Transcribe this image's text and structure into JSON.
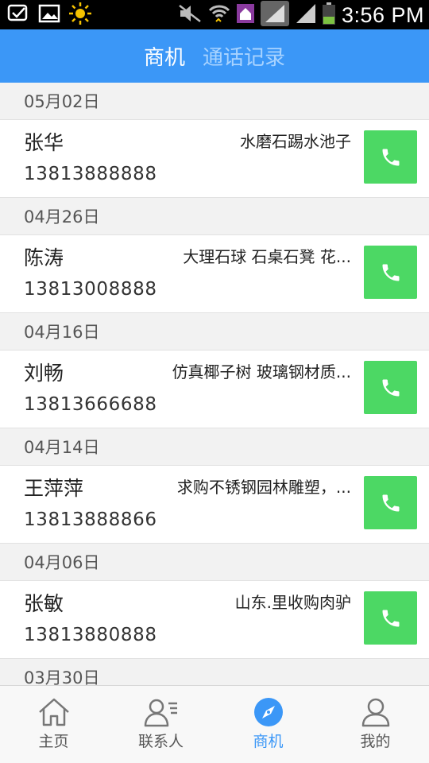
{
  "status_bar": {
    "time": "3:56 PM",
    "icons": [
      "missed-call-icon",
      "image-icon",
      "weather-sun-icon",
      "mute-icon",
      "wifi-icon",
      "home-app-icon",
      "signal-icon",
      "signal-icon",
      "battery-icon"
    ]
  },
  "header": {
    "tabs": [
      {
        "label": "商机",
        "active": true
      },
      {
        "label": "通话记录",
        "active": false
      }
    ],
    "accent": "#3b97f7"
  },
  "groups": [
    {
      "date": "05月02日",
      "items": [
        {
          "name": "张华",
          "product": "水磨石踢水池子",
          "phone": "13813888888"
        }
      ]
    },
    {
      "date": "04月26日",
      "items": [
        {
          "name": "陈涛",
          "product": "大理石球 石桌石凳 花...",
          "phone": "13813008888"
        }
      ]
    },
    {
      "date": "04月16日",
      "items": [
        {
          "name": "刘畅",
          "product": "仿真椰子树 玻璃钢材质...",
          "phone": "13813666688"
        }
      ]
    },
    {
      "date": "04月14日",
      "items": [
        {
          "name": "王萍萍",
          "product": "求购不锈钢园林雕塑，...",
          "phone": "13813888866"
        }
      ]
    },
    {
      "date": "04月06日",
      "items": [
        {
          "name": "张敏",
          "product": "山东.里收购肉驴",
          "phone": "13813880888"
        }
      ]
    },
    {
      "date": "03月30日",
      "items": []
    }
  ],
  "call_button": {
    "icon": "phone-icon",
    "color": "#4cd864"
  },
  "bottom_nav": [
    {
      "label": "主页",
      "icon": "home-icon",
      "active": false
    },
    {
      "label": "联系人",
      "icon": "contacts-icon",
      "active": false
    },
    {
      "label": "商机",
      "icon": "compass-icon",
      "active": true
    },
    {
      "label": "我的",
      "icon": "user-icon",
      "active": false
    }
  ]
}
